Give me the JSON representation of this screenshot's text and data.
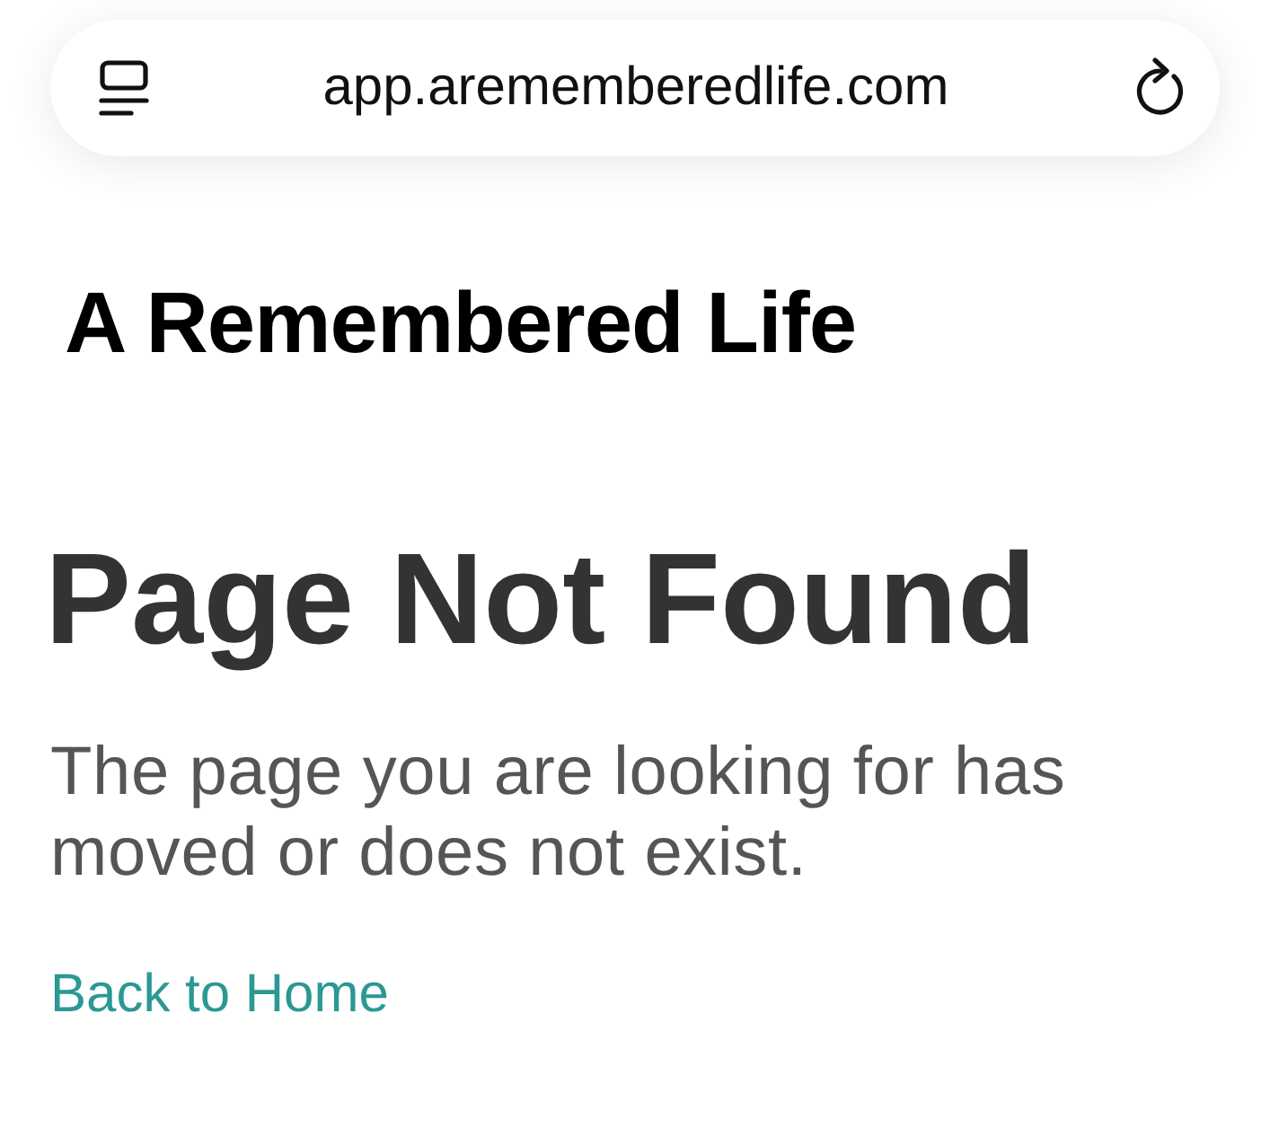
{
  "address_bar": {
    "url": "app.arememberedlife.com"
  },
  "site": {
    "title": "A Remembered Life"
  },
  "error": {
    "heading": "Page Not Found",
    "message": "The page you are looking for has moved or does not exist.",
    "link": "Back to Home"
  }
}
